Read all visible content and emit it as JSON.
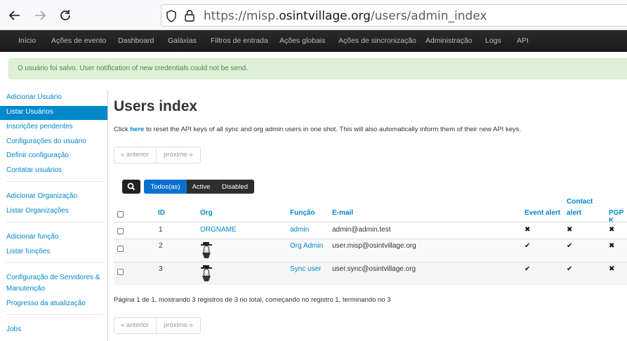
{
  "browser": {
    "url_prefix": "https://misp.",
    "url_domain": "osintvillage.org",
    "url_path": "/users/admin_index"
  },
  "topnav": [
    "Início",
    "Ações de evento",
    "Dashboard",
    "Galáxias",
    "Filtros de entrada",
    "Ações globais",
    "Ações de sincronização",
    "Administração",
    "Logs",
    "API"
  ],
  "alert": "O usuário foi salvo. User notification of new credentials could not be send.",
  "sidebar": {
    "items": [
      "Adicionar Usuário",
      "Listar Usuários",
      "Inscrições pendentes",
      "Configurações do usuário",
      "Definir configuração",
      "Contatar usuários",
      "Adicionar Organização",
      "Listar Organizações",
      "Adicionar função",
      "Listar funções",
      "Configuração de Servidores &",
      "Manutenção",
      "Progresso da atualização",
      "Jobs"
    ]
  },
  "main": {
    "title": "Users index",
    "intro_pre": "Click ",
    "intro_link": "here",
    "intro_post": " to reset the API keys of all sync and org admin users in one shot. This will also automatically inform them of their new API keys.",
    "pager_prev": "« anterior",
    "pager_next": "próximo »",
    "filters": [
      "Todos(as)",
      "Active",
      "Disabled"
    ],
    "summary": "Página 1 de 1, mostrando 3 registros de 3 no total, começando no registro 1, terminando no 3"
  },
  "table": {
    "headers": {
      "id": "ID",
      "org": "Org",
      "role": "Função",
      "email": "E-mail",
      "event_alert": "Event alert",
      "contact_alert_1": "Contact",
      "contact_alert_2": "alert",
      "pgp": "PGP K"
    },
    "rows": [
      {
        "id": "1",
        "org": "ORGNAME",
        "role": "admin",
        "email": "admin@admin.test",
        "event_alert": "✖",
        "contact_alert": "✖",
        "pgp": "✖"
      },
      {
        "id": "2",
        "org": "",
        "role": "Org Admin",
        "email": "user.misp@osintvillage.org",
        "event_alert": "✔",
        "contact_alert": "✔",
        "pgp": "✖"
      },
      {
        "id": "3",
        "org": "",
        "role": "Sync user",
        "email": "user.sync@osintvillage.org",
        "event_alert": "✔",
        "contact_alert": "✔",
        "pgp": "✖"
      }
    ]
  }
}
